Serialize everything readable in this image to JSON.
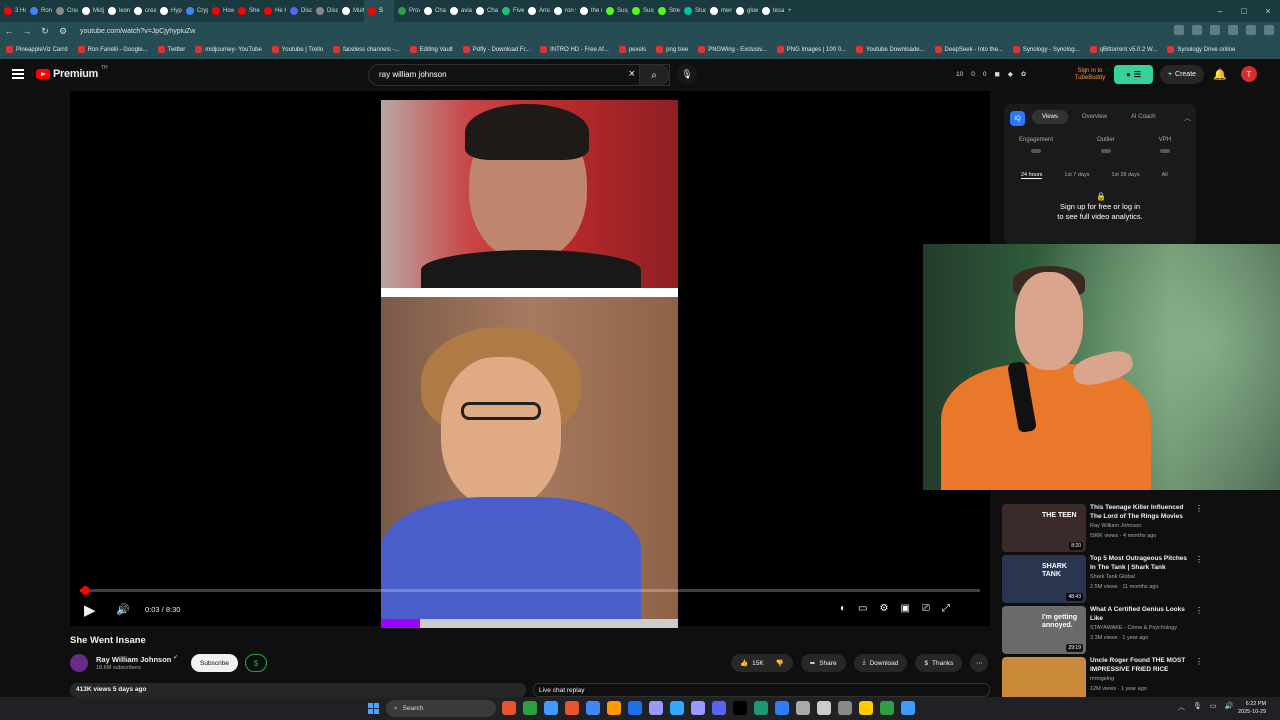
{
  "browser": {
    "tabs": [
      {
        "label": "3 Ho",
        "color": "#ff0000"
      },
      {
        "label": "Ron",
        "color": "#4285f4"
      },
      {
        "label": "Creat",
        "color": "#888888"
      },
      {
        "label": "Midj",
        "color": "#ffffff"
      },
      {
        "label": "leon",
        "color": "#ffffff"
      },
      {
        "label": "creat",
        "color": "#ffffff"
      },
      {
        "label": "Hype",
        "color": "#ffffff"
      },
      {
        "label": "Cryp",
        "color": "#4285f4"
      },
      {
        "label": "How",
        "color": "#ff0000"
      },
      {
        "label": "She V",
        "color": "#ff0000"
      },
      {
        "label": "He K",
        "color": "#ff0000"
      },
      {
        "label": "Disco",
        "color": "#5865f2"
      },
      {
        "label": "Disc",
        "color": "#888888"
      },
      {
        "label": "Mult",
        "color": "#ffffff"
      },
      {
        "label": "S",
        "color": "#ff0000",
        "active": true
      },
      {
        "label": "Prov",
        "color": "#2ea043"
      },
      {
        "label": "Chat",
        "color": "#ffffff"
      },
      {
        "label": "aviat",
        "color": "#ffffff"
      },
      {
        "label": "Chat",
        "color": "#ffffff"
      },
      {
        "label": "Fiver",
        "color": "#1dbf73"
      },
      {
        "label": "Ama",
        "color": "#ffffff"
      },
      {
        "label": "ron l",
        "color": "#ffffff"
      },
      {
        "label": "the n",
        "color": "#ffffff"
      },
      {
        "label": "Susp",
        "color": "#53fc18"
      },
      {
        "label": "Susp",
        "color": "#53fc18"
      },
      {
        "label": "Strea",
        "color": "#53fc18"
      },
      {
        "label": "Stud",
        "color": "#00c2a8"
      },
      {
        "label": "merc",
        "color": "#ffffff"
      },
      {
        "label": "glow",
        "color": "#ffffff"
      },
      {
        "label": "tesa",
        "color": "#ffffff"
      }
    ],
    "new_tab": "+",
    "window_controls": [
      "–",
      "□",
      "×"
    ],
    "url": "youtube.com/watch?v=JpCjyhypiuZw",
    "bookmarks": [
      "PineappleViz Carrd",
      "Ron Fanelli - Google...",
      "Twitter",
      "midjourney- YouTube",
      "Youtube | Trello",
      "faceless channels -...",
      "Editing Vault",
      "Pdfly - Download Fr...",
      "INTRO HD - Free Af...",
      "pexels",
      "png tree",
      "PNGWing - Exclusiv...",
      "PNG Images | 100 0...",
      "Youtube Downloade...",
      "DeepSeek - Into the...",
      "Synology - Synolog...",
      "qBittorrent v5.0.2 W...",
      "Synology Drive online"
    ]
  },
  "yt_header": {
    "logo_text": "Premium",
    "logo_sup": "TH",
    "search_query": "ray william johnson",
    "stats": [
      "10",
      "0",
      "0"
    ],
    "tubebuddy_login": "Sign in to TubeBuddy",
    "create_label": "Create",
    "avatar_letter": "T"
  },
  "player": {
    "time": "0:03 / 8:30",
    "progress_fraction": 0.006,
    "frame_progress_fraction": 0.13
  },
  "analytics": {
    "logo": "IQ",
    "tabs": [
      "Views",
      "Overview",
      "AI Coach"
    ],
    "active_tab": "Views",
    "metrics": [
      "Engagement",
      "Outlier",
      "VPH"
    ],
    "periods": [
      "24 hours",
      "1st 7 days",
      "1st 28 days",
      "All"
    ],
    "cta_line1": "Sign up for free or log in",
    "cta_line2": "to see full video analytics."
  },
  "video": {
    "title": "She Went Insane",
    "channel": "Ray William Johnson",
    "subscribers": "18.6M subscribers",
    "subscribe_label": "Subscribe",
    "dollar_label": "$",
    "likes": "15K",
    "share_label": "Share",
    "download_label": "Download",
    "thanks_label": "Thanks",
    "meta": "413K views  5 days ago",
    "live_chat": "Live chat replay"
  },
  "suggested": [
    {
      "title": "This Teenage Killer Influenced The Lord of The Rings Movies",
      "channel": "Ray William Johnson",
      "meta": "596K views · 4 months ago",
      "duration": "8:20",
      "thumb_color": "#3a2a2a",
      "thumb_text": "THE TEEN"
    },
    {
      "title": "Top 5 Most Outrageous Pitches In The Tank | Shark Tank",
      "channel": "Shark Tank Global",
      "meta": "2.5M views · 11 months ago",
      "duration": "48:43",
      "thumb_color": "#2a3550",
      "thumb_text": "SHARK TANK"
    },
    {
      "title": "What A Certified Genius Looks Like",
      "channel": "STAYAWAKE - Crime & Psychology",
      "meta": "3.3M views · 1 year ago",
      "duration": "29:19",
      "thumb_color": "#6a6a6a",
      "thumb_text": "I'm getting annoyed."
    },
    {
      "title": "Uncle Roger Found THE MOST IMPRESSIVE FRIED RICE",
      "channel": "mrnigelng",
      "meta": "12M views · 1 year ago",
      "duration": "",
      "thumb_color": "#c98a3a",
      "thumb_text": ""
    }
  ],
  "taskbar": {
    "search_label": "Search",
    "time": "6:22 PM",
    "date": "2025-10-29",
    "app_colors": [
      "#e8542c",
      "#2ea043",
      "#3f9bff",
      "#e8542c",
      "#4285f4",
      "#ff9a00",
      "#1f6feb",
      "#9999ff",
      "#31a8ff",
      "#9999ff",
      "#5865f2",
      "#000000",
      "#1b9a71",
      "#2d7df6",
      "#aaaaaa",
      "#cccccc",
      "#888888",
      "#ffcc00",
      "#2ea043",
      "#3f9bff"
    ]
  }
}
